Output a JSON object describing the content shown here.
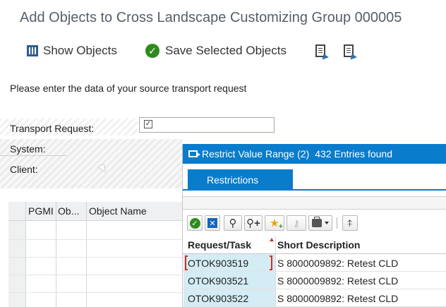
{
  "window": {
    "title": "Add Objects to Cross Landscape Customizing Group 000005"
  },
  "toolbar": {
    "show_objects_label": "Show Objects",
    "save_selected_label": "Save Selected Objects"
  },
  "form": {
    "instruction": "Please enter the data of your source transport request",
    "transport_request_label": "Transport Request:",
    "transport_request_value": "",
    "system_label": "System:",
    "client_label": "Client:"
  },
  "object_table": {
    "columns": [
      "PGMI",
      "Ob...",
      "Object Name"
    ]
  },
  "popup": {
    "title": "Restrict Value Range (2)",
    "entries_found": "432 Entries found",
    "tab_restrictions": "Restrictions",
    "columns": [
      "Request/Task",
      "Short Description"
    ],
    "rows": [
      {
        "request": "OTOK903519",
        "description": "S 8000009892: Retest CLD"
      },
      {
        "request": "OTOK903521",
        "description": "S 8000009892: Retest CLD"
      },
      {
        "request": "OTOK903522",
        "description": "S 8000009892: Retest CLD"
      }
    ]
  },
  "colors": {
    "sap_blue": "#0a7ccc",
    "ok_green": "#2e8b1e",
    "selected_column": "#d4ecf4",
    "focus_red": "#d62d20"
  },
  "icons": {
    "toolbar": [
      "list-icon",
      "check-circle-icon",
      "document-export-icon",
      "document-import-icon"
    ],
    "popup_toolbar": [
      "ok-icon",
      "cancel-icon",
      "search-icon",
      "search-next-icon",
      "add-favorite-icon",
      "key-icon",
      "print-icon",
      "sort-icon"
    ]
  }
}
